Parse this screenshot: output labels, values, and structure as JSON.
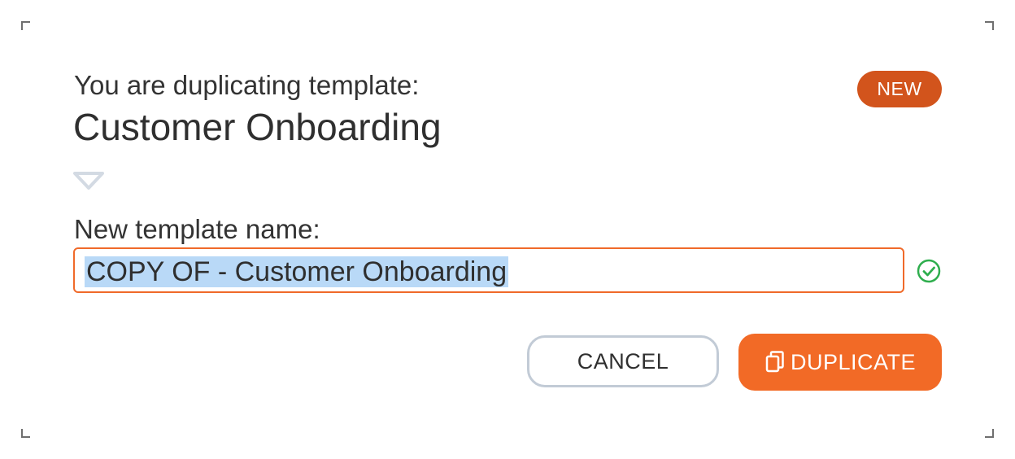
{
  "dialog": {
    "subtitle": "You are duplicating template:",
    "template_name": "Customer Onboarding",
    "badge": "NEW",
    "field_label": "New template name:",
    "input_value": "COPY OF - Customer Onboarding",
    "cancel_label": "CANCEL",
    "duplicate_label": "DUPLICATE"
  },
  "icons": {
    "expand": "chevron-down-icon",
    "valid": "check-circle-icon",
    "duplicate": "copy-icon"
  },
  "colors": {
    "accent": "#f26a26",
    "badge": "#d2541c",
    "valid": "#2fae4e",
    "selection": "#b9d9f7"
  }
}
